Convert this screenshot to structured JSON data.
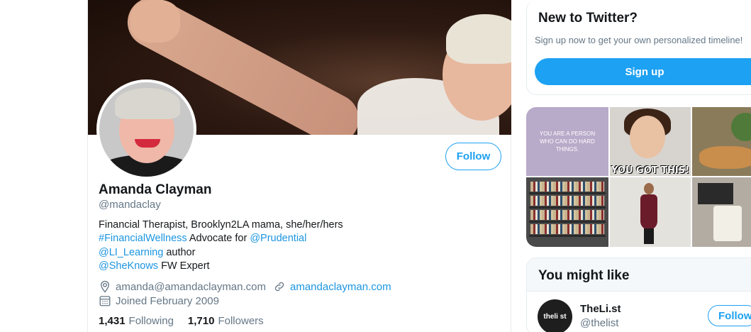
{
  "profile": {
    "name": "Amanda Clayman",
    "handle": "@mandaclay",
    "follow_label": "Follow",
    "bio_line1": "Financial Therapist, Brooklyn2LA mama, she/her/hers",
    "bio_hashtag": "#FinancialWellness",
    "bio_mid": " Advocate for ",
    "bio_mention1": "@Prudential",
    "bio_mention2": "@LI_Learning",
    "bio_author": " author",
    "bio_mention3": "@SheKnows",
    "bio_expert": " FW Expert",
    "location": "amanda@amandaclayman.com",
    "website": "amandaclayman.com",
    "joined": "Joined February 2009",
    "following_count": "1,431",
    "following_label": "Following",
    "followers_count": "1,710",
    "followers_label": "Followers"
  },
  "signup": {
    "title": "New to Twitter?",
    "subtitle": "Sign up now to get your own personalized timeline!",
    "button": "Sign up"
  },
  "media": {
    "tile1_text": "YOU ARE A PERSON WHO CAN DO HARD THINGS.",
    "tile2_caption": "YOU GOT THIS!"
  },
  "you_might_like": {
    "title": "You might like",
    "accounts": [
      {
        "name": "TheLi.st",
        "handle": "@thelist",
        "avatar_text": "theli st",
        "follow_label": "Follow"
      }
    ]
  },
  "colors": {
    "accent": "#1da1f2",
    "link": "#1b95e0",
    "secondary_text": "#657786"
  },
  "icons": {
    "location": "location-pin-icon",
    "link": "link-icon",
    "calendar": "calendar-icon"
  }
}
